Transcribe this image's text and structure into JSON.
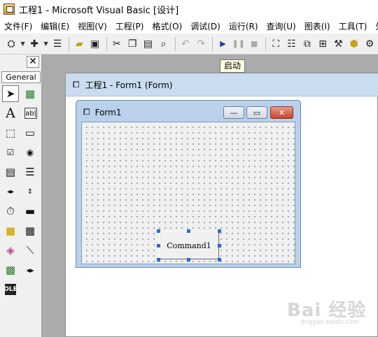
{
  "window": {
    "title": "工程1 - Microsoft Visual Basic [设计]"
  },
  "menubar": [
    {
      "label": "文件(F)"
    },
    {
      "label": "编辑(E)"
    },
    {
      "label": "视图(V)"
    },
    {
      "label": "工程(P)"
    },
    {
      "label": "格式(O)"
    },
    {
      "label": "调试(D)"
    },
    {
      "label": "运行(R)"
    },
    {
      "label": "查询(U)"
    },
    {
      "label": "图表(I)"
    },
    {
      "label": "工具(T)"
    },
    {
      "label": "外接程"
    }
  ],
  "toolbar": {
    "tooltip": "启动",
    "icons": [
      "add-project-icon",
      "add-form-icon",
      "menu-editor-icon",
      "open-icon",
      "save-icon",
      "cut-icon",
      "copy-icon",
      "paste-icon",
      "find-icon",
      "undo-icon",
      "redo-icon",
      "start-icon",
      "break-icon",
      "end-icon",
      "project-explorer-icon",
      "properties-icon",
      "form-layout-icon",
      "object-browser-icon",
      "toolbox-icon",
      "data-view-icon",
      "component-manager-icon"
    ]
  },
  "toolbox": {
    "tab_label": "General",
    "close_glyph": "✕",
    "tools": [
      "pointer",
      "picturebox",
      "label",
      "textbox",
      "frame",
      "commandbutton",
      "checkbox",
      "optionbutton",
      "combobox",
      "listbox",
      "hscrollbar",
      "vscrollbar",
      "timer",
      "drivelistbox",
      "dirlistbox",
      "filelistbox",
      "shape",
      "line",
      "image",
      "data",
      "ole"
    ]
  },
  "designer": {
    "title": "工程1 - Form1 (Form)"
  },
  "form": {
    "title": "Form1",
    "min_glyph": "—",
    "max_glyph": "▭",
    "close_glyph": "✕"
  },
  "command_button": {
    "label": "Command1"
  },
  "watermark": {
    "text": "Bai 经验",
    "sub": "jingyan.baidu.com"
  }
}
